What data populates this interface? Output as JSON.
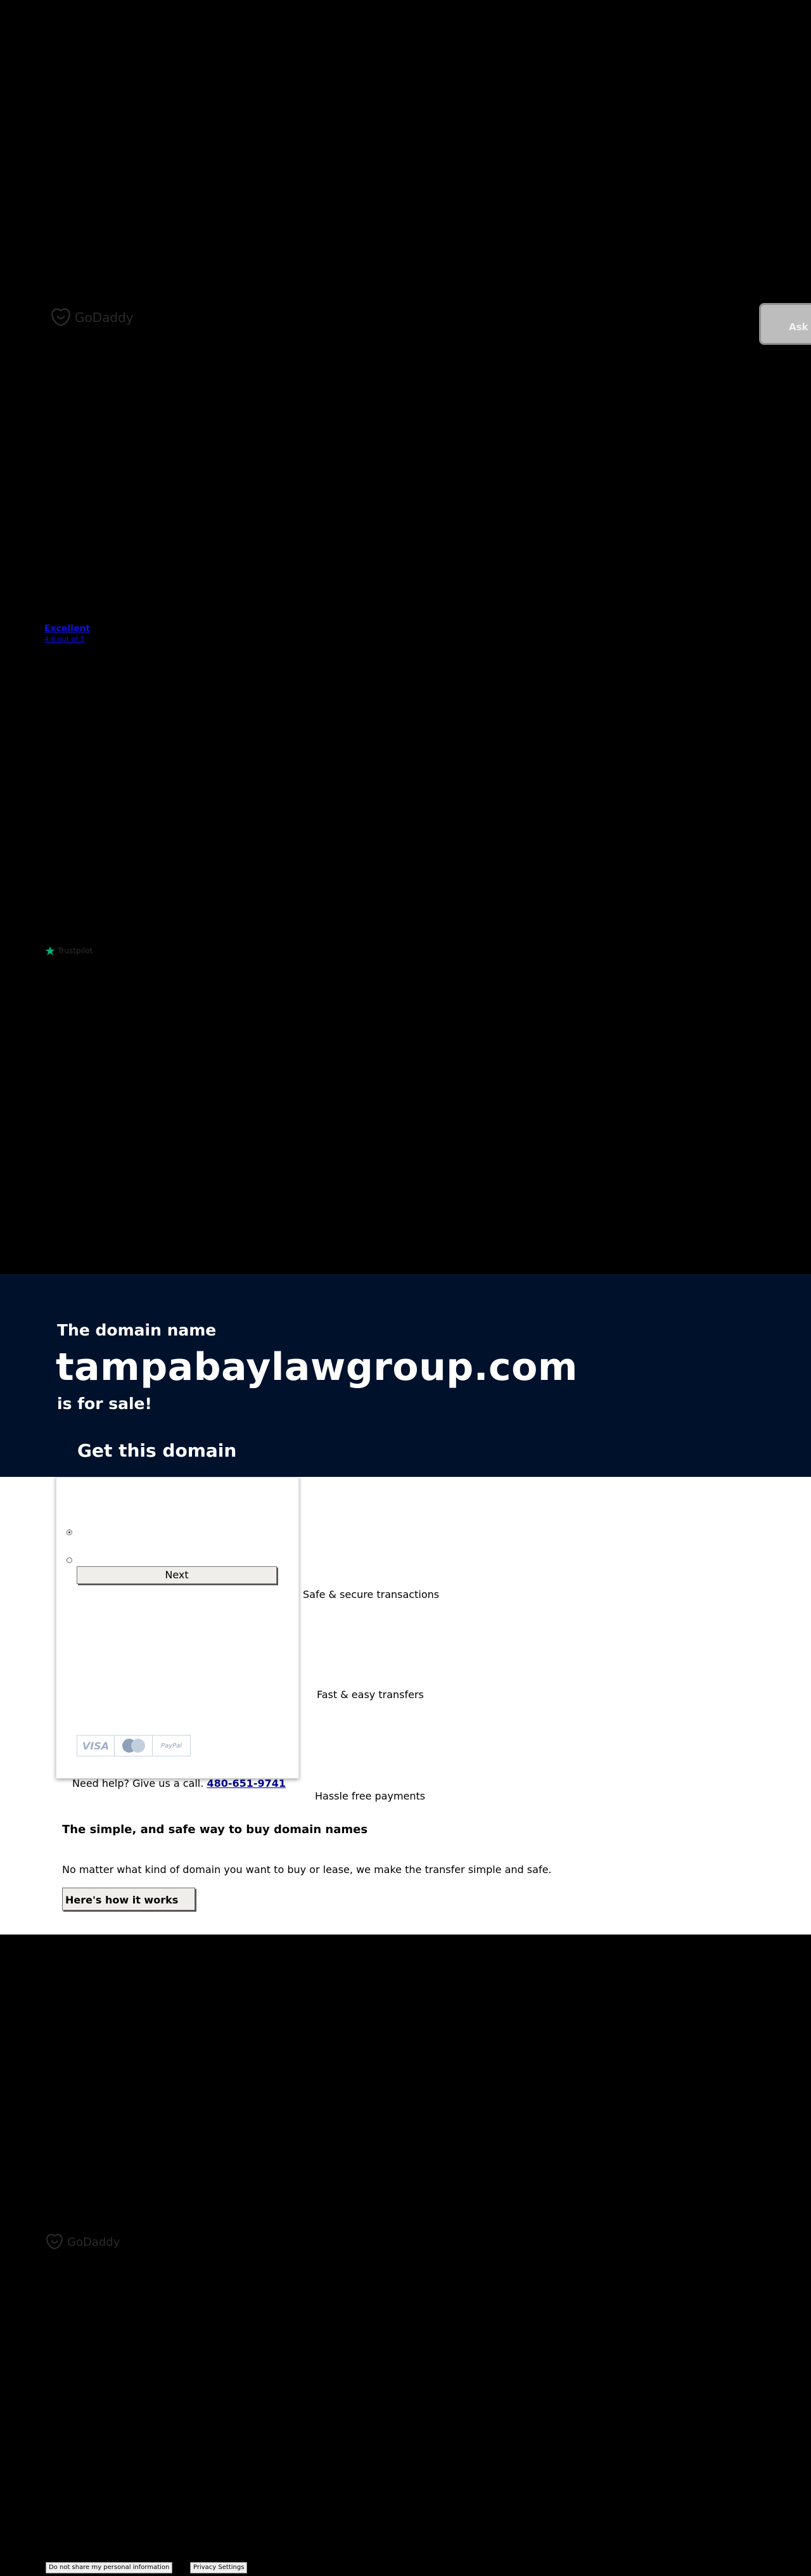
{
  "header": {
    "logo_text": "GoDaddy",
    "ask_button_label": "Ask a"
  },
  "rating": {
    "label": "Excellent",
    "sublabel": "4.6 out of 5"
  },
  "trustpilot": {
    "label": "Trustpilot"
  },
  "hero": {
    "pre_text": "The domain name",
    "domain": "tampabaylawgroup.com",
    "post_text": "is for sale!",
    "get_domain_label": "Get this domain"
  },
  "purchase_card": {
    "next_button_label": "Next",
    "payment_methods": [
      "VISA",
      "Mastercard",
      "PayPal"
    ]
  },
  "help": {
    "text": "Need help? Give us a call.",
    "phone": "480-651-9741"
  },
  "features": [
    "Safe & secure transactions",
    "Fast & easy transfers",
    "Hassle free payments"
  ],
  "info": {
    "title": "The simple, and safe way to buy domain names",
    "body": "No matter what kind of domain you want to buy or lease, we make the transfer simple and safe.",
    "button_label": "Here's how it works"
  },
  "footer": {
    "logo_text": "GoDaddy",
    "do_not_share_label": "Do not share my personal information",
    "privacy_settings_label": "Privacy Settings"
  }
}
